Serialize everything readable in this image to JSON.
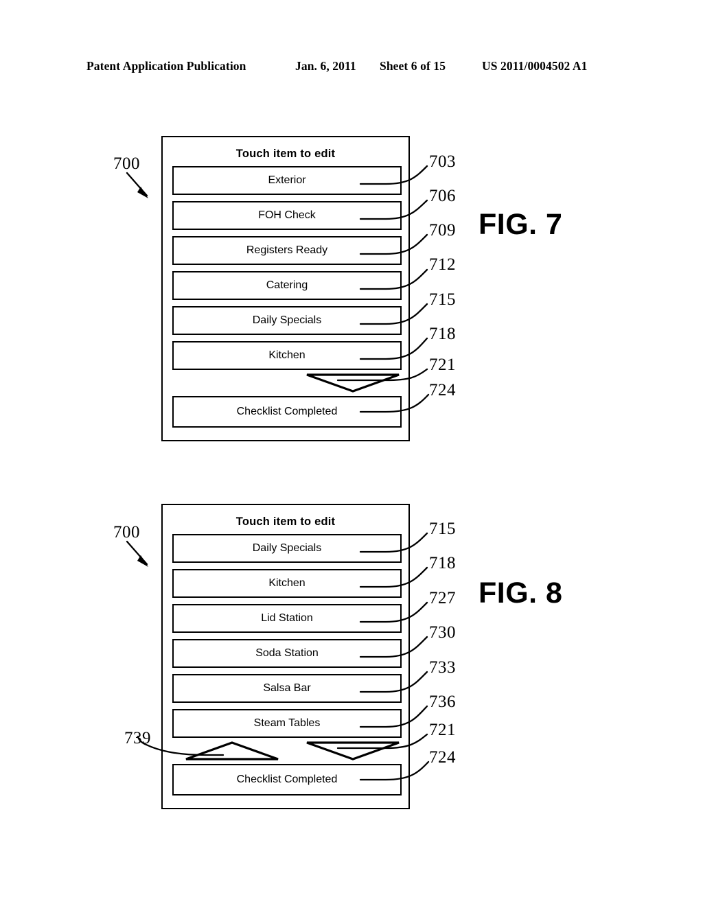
{
  "header": {
    "publication": "Patent Application Publication",
    "date": "Jan. 6, 2011",
    "sheet": "Sheet 6 of 15",
    "patent_number": "US 2011/0004502 A1"
  },
  "figures": [
    {
      "caption": "FIG. 7",
      "device_ref": "700",
      "title": "Touch item to edit",
      "buttons": [
        {
          "label": "Exterior",
          "ref": "703"
        },
        {
          "label": "FOH Check",
          "ref": "706"
        },
        {
          "label": "Registers Ready",
          "ref": "709"
        },
        {
          "label": "Catering",
          "ref": "712"
        },
        {
          "label": "Daily Specials",
          "ref": "715"
        },
        {
          "label": "Kitchen",
          "ref": "718"
        }
      ],
      "scroll_down_ref": "721",
      "scroll_up_ref": null,
      "footer_button": {
        "label": "Checklist Completed",
        "ref": "724"
      }
    },
    {
      "caption": "FIG. 8",
      "device_ref": "700",
      "title": "Touch item to edit",
      "buttons": [
        {
          "label": "Daily Specials",
          "ref": "715"
        },
        {
          "label": "Kitchen",
          "ref": "718"
        },
        {
          "label": "Lid Station",
          "ref": "727"
        },
        {
          "label": "Soda Station",
          "ref": "730"
        },
        {
          "label": "Salsa Bar",
          "ref": "733"
        },
        {
          "label": "Steam Tables",
          "ref": "736"
        }
      ],
      "scroll_down_ref": "721",
      "scroll_up_ref": "739",
      "footer_button": {
        "label": "Checklist Completed",
        "ref": "724"
      }
    }
  ],
  "colors": {
    "ink": "#000000",
    "paper": "#ffffff"
  }
}
